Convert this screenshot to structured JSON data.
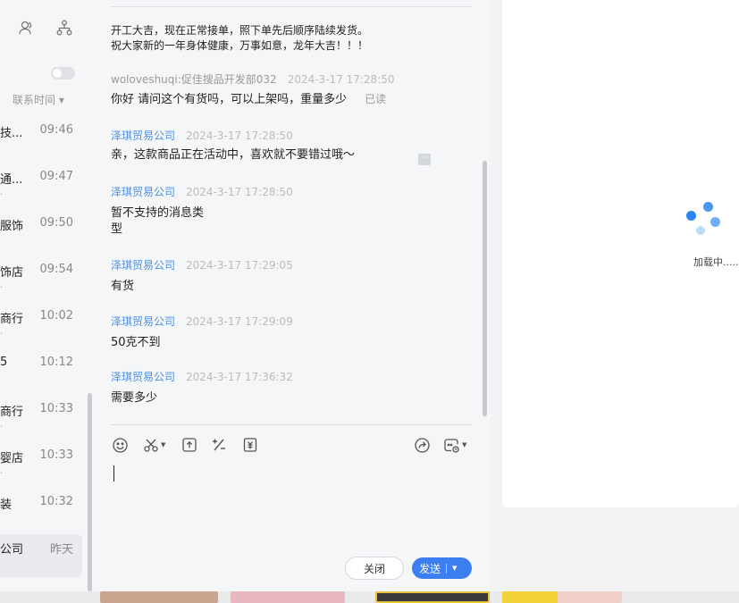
{
  "left_panel": {
    "sort_label": "联系时间 ▾",
    "contacts": [
      {
        "name": "技...",
        "time": "09:46",
        "sub": ""
      },
      {
        "name": "通...",
        "time": "09:47",
        "sub": "."
      },
      {
        "name": "服饰",
        "time": "09:50",
        "sub": ""
      },
      {
        "name": "饰店",
        "time": "09:54",
        "sub": "."
      },
      {
        "name": "商行",
        "time": "10:02",
        "sub": "."
      },
      {
        "name": "5",
        "time": "10:12",
        "sub": ""
      },
      {
        "name": "商行",
        "time": "10:33",
        "sub": "."
      },
      {
        "name": "婴店",
        "time": "10:33",
        "sub": "."
      },
      {
        "name": "装",
        "time": "10:32",
        "sub": ""
      },
      {
        "name": "公司",
        "time": "昨天",
        "sub": ""
      }
    ]
  },
  "chat": {
    "announcement_line1": "开工大吉，现在正常接单，照下单先后顺序陆续发货。",
    "announcement_line2": "祝大家新的一年身体健康，万事如意，龙年大吉！！！",
    "messages": [
      {
        "sender": "woloveshuqi:促佳搜品开发部032",
        "time": "2024-3-17 17:28:50",
        "text": "你好 请问这个有货吗，可以上架吗，重量多少",
        "status": "已读"
      },
      {
        "sender": "泽琪贸易公司",
        "time": "2024-3-17 17:28:50",
        "text": "亲，这款商品正在活动中，喜欢就不要错过哦～"
      },
      {
        "sender": "泽琪贸易公司",
        "time": "2024-3-17 17:28:50",
        "text_line1": "暂不支持的消息类",
        "text_line2": "型"
      },
      {
        "sender": "泽琪贸易公司",
        "time": "2024-3-17 17:29:05",
        "text": "有货"
      },
      {
        "sender": "泽琪贸易公司",
        "time": "2024-3-17 17:29:09",
        "text": "50克不到"
      },
      {
        "sender": "泽琪贸易公司",
        "time": "2024-3-17 17:36:32",
        "text": "需要多少"
      }
    ],
    "more_label": "···",
    "close_label": "关闭",
    "send_label": "发送",
    "toolbar_icons": [
      "emoji-icon",
      "scissors-icon",
      "upload-icon",
      "percent-icon",
      "coupon-icon",
      "share-icon",
      "quick-reply-icon"
    ]
  },
  "right_panel": {
    "loading_text": "加载中......"
  },
  "colors": {
    "accent": "#3d7ff0",
    "sender_link": "#4a8fe7",
    "loader_dark": "#2b85f1",
    "loader_light": "#9fcaf5"
  }
}
